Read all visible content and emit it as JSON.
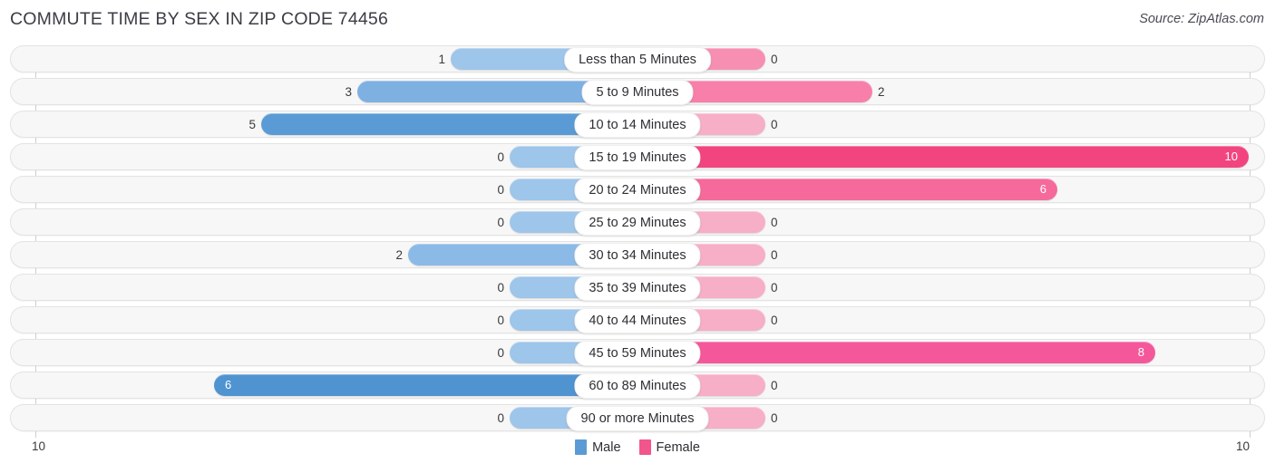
{
  "header": {
    "title": "COMMUTE TIME BY SEX IN ZIP CODE 74456",
    "source": "Source: ZipAtlas.com"
  },
  "axis": {
    "left_tick": "10",
    "right_tick": "10"
  },
  "legend": {
    "items": [
      {
        "label": "Male",
        "color": "#5b9bd5"
      },
      {
        "label": "Female",
        "color": "#f2548c"
      }
    ]
  },
  "chart_data": {
    "type": "bar",
    "orientation": "horizontal-diverging",
    "title": "COMMUTE TIME BY SEX IN ZIP CODE 74456",
    "xlabel": "",
    "ylabel": "",
    "xlim": [
      10,
      10
    ],
    "grid": false,
    "legend_position": "bottom-center",
    "categories": [
      "Less than 5 Minutes",
      "5 to 9 Minutes",
      "10 to 14 Minutes",
      "15 to 19 Minutes",
      "20 to 24 Minutes",
      "25 to 29 Minutes",
      "30 to 34 Minutes",
      "35 to 39 Minutes",
      "40 to 44 Minutes",
      "45 to 59 Minutes",
      "60 to 89 Minutes",
      "90 or more Minutes"
    ],
    "series": [
      {
        "name": "Male",
        "side": "left",
        "values": [
          1,
          3,
          5,
          0,
          0,
          0,
          2,
          0,
          0,
          0,
          6,
          0
        ]
      },
      {
        "name": "Female",
        "side": "right",
        "values": [
          0,
          2,
          0,
          10,
          6,
          0,
          0,
          0,
          0,
          8,
          0,
          0
        ]
      }
    ]
  },
  "rows": [
    {
      "category": "Less than 5 Minutes",
      "male": "1",
      "female": "0",
      "male_w": 205,
      "female_w": 140,
      "male_color": "#9ec5ea",
      "female_color": "#f78fb3",
      "male_inside": false,
      "female_inside": false
    },
    {
      "category": "5 to 9 Minutes",
      "male": "3",
      "female": "2",
      "male_w": 308,
      "female_w": 258,
      "male_color": "#7eb0e2",
      "female_color": "#f77fa9",
      "male_inside": false,
      "female_inside": false
    },
    {
      "category": "10 to 14 Minutes",
      "male": "5",
      "female": "0",
      "male_w": 414,
      "female_w": 140,
      "male_color": "#5b9bd5",
      "female_color": "#f7aec7",
      "male_inside": false,
      "female_inside": false
    },
    {
      "category": "15 to 19 Minutes",
      "male": "0",
      "female": "10",
      "male_w": 140,
      "female_w": 673,
      "male_color": "#9ec5ea",
      "female_color": "#f2457f",
      "male_inside": false,
      "female_inside": true
    },
    {
      "category": "20 to 24 Minutes",
      "male": "0",
      "female": "6",
      "male_w": 140,
      "female_w": 462,
      "male_color": "#9ec5ea",
      "female_color": "#f56a9b",
      "male_inside": false,
      "female_inside": true
    },
    {
      "category": "25 to 29 Minutes",
      "male": "0",
      "female": "0",
      "male_w": 140,
      "female_w": 140,
      "male_color": "#9ec5ea",
      "female_color": "#f7aec7",
      "male_inside": false,
      "female_inside": false
    },
    {
      "category": "30 to 34 Minutes",
      "male": "2",
      "female": "0",
      "male_w": 252,
      "female_w": 140,
      "male_color": "#8cbae6",
      "female_color": "#f7aec7",
      "male_inside": false,
      "female_inside": false
    },
    {
      "category": "35 to 39 Minutes",
      "male": "0",
      "female": "0",
      "male_w": 140,
      "female_w": 140,
      "male_color": "#9ec5ea",
      "female_color": "#f7aec7",
      "male_inside": false,
      "female_inside": false
    },
    {
      "category": "40 to 44 Minutes",
      "male": "0",
      "female": "0",
      "male_w": 140,
      "female_w": 140,
      "male_color": "#9ec5ea",
      "female_color": "#f7aec7",
      "male_inside": false,
      "female_inside": false
    },
    {
      "category": "45 to 59 Minutes",
      "male": "0",
      "female": "8",
      "male_w": 140,
      "female_w": 570,
      "male_color": "#9ec5ea",
      "female_color": "#f4589a",
      "male_inside": false,
      "female_inside": true
    },
    {
      "category": "60 to 89 Minutes",
      "male": "6",
      "female": "0",
      "male_w": 466,
      "female_w": 140,
      "male_color": "#4f93d1",
      "female_color": "#f7aec7",
      "male_inside": true,
      "female_inside": false
    },
    {
      "category": "90 or more Minutes",
      "male": "0",
      "female": "0",
      "male_w": 140,
      "female_w": 140,
      "male_color": "#9ec5ea",
      "female_color": "#f7aec7",
      "male_inside": false,
      "female_inside": false
    }
  ]
}
